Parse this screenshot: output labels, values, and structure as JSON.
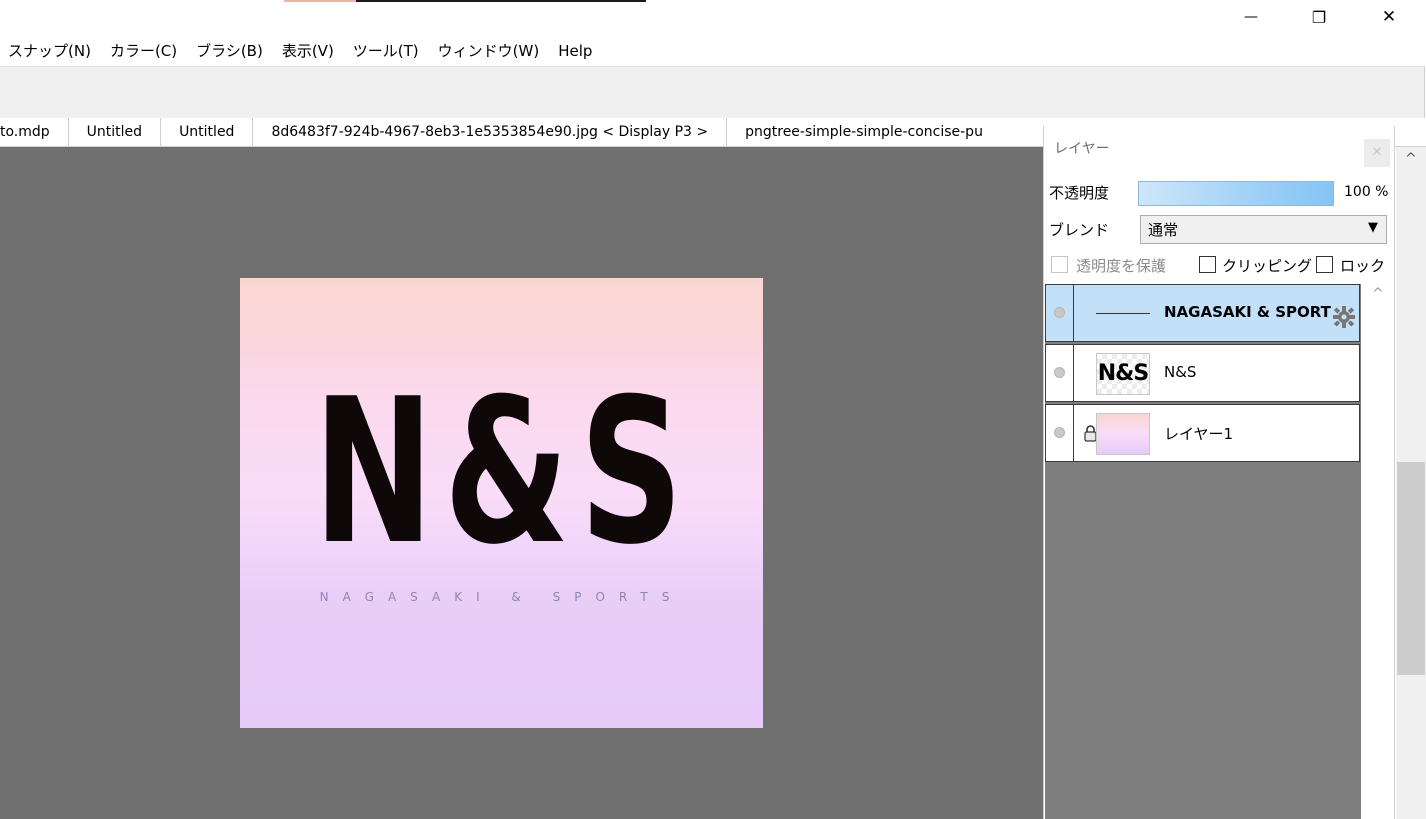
{
  "window": {
    "minimize_glyph": "—",
    "restore_glyph": "❐",
    "close_glyph": "✕"
  },
  "menu": [
    "スナップ(N)",
    "カラー(C)",
    "ブラシ(B)",
    "表示(V)",
    "ツール(T)",
    "ウィンドウ(W)",
    "Help"
  ],
  "tabs": [
    "to.mdp",
    "Untitled",
    "Untitled",
    "8d6483f7-924b-4967-8eb3-1e5353854e90.jpg < Display P3 >",
    "pngtree-simple-simple-concise-pu"
  ],
  "canvas": {
    "logo_main": "N&S",
    "logo_sub": "NAGASAKI & SPORTS"
  },
  "layer_panel": {
    "title": "レイヤー",
    "close_glyph": "✕",
    "opacity_label": "不透明度",
    "opacity_value": "100 %",
    "opacity_fraction": 1.0,
    "blend_label": "ブレンド",
    "blend_value": "通常",
    "blend_arrow": "▼",
    "protect_alpha_label": "透明度を保護",
    "clipping_label": "クリッピング",
    "lock_label": "ロック",
    "scroll_up_glyph": "^",
    "layers": [
      {
        "name": "NAGASAKI & SPORT",
        "selected": true,
        "type": "text"
      },
      {
        "name": "N&S",
        "selected": false,
        "type": "image",
        "thumb_text": "N&S"
      },
      {
        "name": "レイヤー1",
        "selected": false,
        "type": "gradient",
        "locked": true
      }
    ]
  },
  "right_scroll": {
    "up_glyph": "^"
  }
}
